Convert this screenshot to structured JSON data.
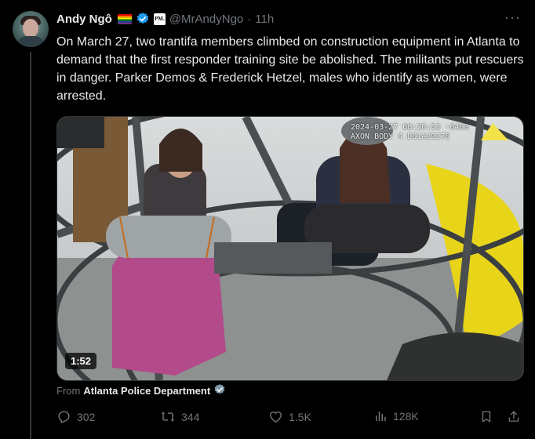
{
  "author": {
    "display_name": "Andy Ngô",
    "handle": "@MrAndyNgo",
    "separator": "·",
    "time": "11h",
    "pm_badge": "PM."
  },
  "tweet": {
    "text": "On March 27, two trantifa members climbed on construction equipment in Atlanta to demand that the first responder training site be abolished. The militants put rescuers in danger. Parker Demos & Frederick Hetzel, males who identify as women, were arrested."
  },
  "media": {
    "overlay_line1": "2024-03-27 08:26:53 -0400",
    "overlay_line2": "AXON BODY 4 D01A2927E",
    "duration": "1:52"
  },
  "source": {
    "prefix": "From",
    "org": "Atlanta Police Department"
  },
  "actions": {
    "replies": "302",
    "reposts": "344",
    "likes": "1.5K",
    "views": "128K"
  },
  "colors": {
    "background": "#000000",
    "text": "#e7e9ea",
    "muted": "#71767b",
    "verified": "#1d9bf0",
    "source_badge": "#829aab"
  }
}
